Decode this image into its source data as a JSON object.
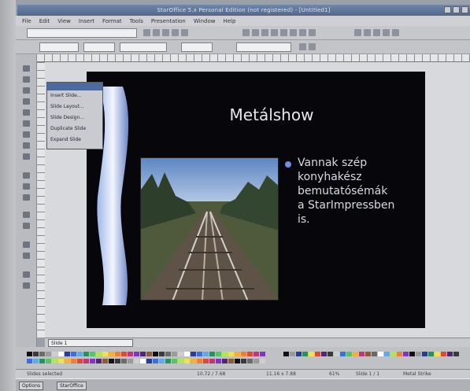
{
  "window": {
    "title": "StarOffice 5.x Personal Edition (not registered) - [Untitled1]"
  },
  "menu": [
    "File",
    "Edit",
    "View",
    "Insert",
    "Format",
    "Tools",
    "Presentation",
    "Window",
    "Help"
  ],
  "popup_menu": {
    "items": [
      "Insert Slide...",
      "Slide Layout...",
      "Slide Design...",
      "Duplicate Slide",
      "Expand Slide"
    ]
  },
  "slide": {
    "title": "Metálshow",
    "bullet": "Vannak szép\nkonyhakész\nbemutatósémák\na StarImpressben\nis."
  },
  "tabs": {
    "current": "Slide 1"
  },
  "status": {
    "mode": "Slides selected",
    "position": "10.72 / 7.68",
    "size": "11.16 x 7.88",
    "zoom": "61%",
    "slide": "Slide 1 / 1",
    "layout": "Metal Strike"
  },
  "taskbar": {
    "items": [
      "Options",
      "StarOffice"
    ]
  },
  "colors": {
    "titlebar": "#5b7296",
    "slide_bg": "#07070b",
    "bullet": "#6f8edb",
    "text": "#d7dae2"
  },
  "icons": [
    "close-icon",
    "minimize-icon",
    "maximize-icon",
    "bullet-icon"
  ]
}
